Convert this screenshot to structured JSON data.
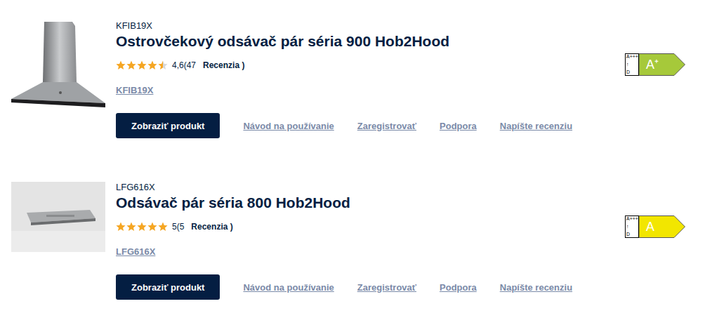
{
  "products": [
    {
      "code": "KFIB19X",
      "title": "Ostrovčekový odsávač pár séria 900 Hob2Hood",
      "image": "island-hood",
      "stars": 4.5,
      "rating": "4,6",
      "count": "(47",
      "reviews_label": "Recenzia )",
      "link": "KFIB19X",
      "button": "Zobraziť produkt",
      "links": [
        "Návod na používanie",
        "Zaregistrovať",
        "Podpora",
        "Napíšte recenziu"
      ],
      "energy": {
        "top": "A+++",
        "arrow": "↑",
        "bottom": "D",
        "class": "A⁺",
        "color": "#a6c93a"
      }
    },
    {
      "code": "LFG616X",
      "title": "Odsávač pár séria 800 Hob2Hood",
      "image": "built-in-hood",
      "stars": 5,
      "rating": "5",
      "count": "(5",
      "reviews_label": "Recenzia )",
      "link": "LFG616X",
      "button": "Zobraziť produkt",
      "links": [
        "Návod na používanie",
        "Zaregistrovať",
        "Podpora",
        "Napíšte recenziu"
      ],
      "energy": {
        "top": "A+++",
        "arrow": "↑",
        "bottom": "D",
        "class": "A",
        "color": "#f2e600"
      }
    }
  ]
}
